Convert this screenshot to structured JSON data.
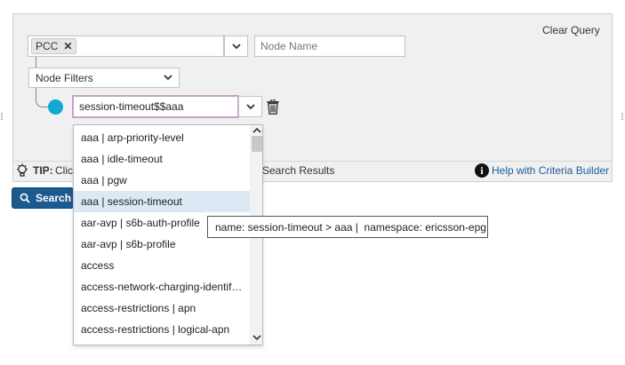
{
  "builder": {
    "clear_query": "Clear Query",
    "node_type_tag": "PCC",
    "node_name_placeholder": "Node Name",
    "node_filters_label": "Node Filters",
    "filter_value": "session-timeout$$aaa"
  },
  "tip": {
    "label": "TIP:",
    "text_before": "Clic",
    "text_after": "e Search Results",
    "help_link": "Help with Criteria Builder"
  },
  "search_button": "Search",
  "dropdown": {
    "options": [
      "aaa | arp-priority-level",
      "aaa | idle-timeout",
      "aaa | pgw",
      "aaa | session-timeout",
      "aar-avp | s6b-auth-profile",
      "aar-avp | s6b-profile",
      "access",
      "access-network-charging-identif…",
      "access-restrictions | apn",
      "access-restrictions | logical-apn"
    ],
    "highlighted_index": 3
  },
  "tooltip": "name: session-timeout > aaa |  namespace: ericsson-epg",
  "icons": {
    "remove_tag": "close-icon",
    "dropdown": "chevron-down-icon",
    "delete": "trash-icon",
    "tip": "lightbulb-icon",
    "help": "info-icon",
    "search": "search-icon"
  },
  "colors": {
    "accent_blue": "#1b5a8f",
    "filter_dot": "#12a8d6",
    "focus_border": "#c9a0c9",
    "highlight": "#dde8f5",
    "link": "#1f5c99"
  }
}
